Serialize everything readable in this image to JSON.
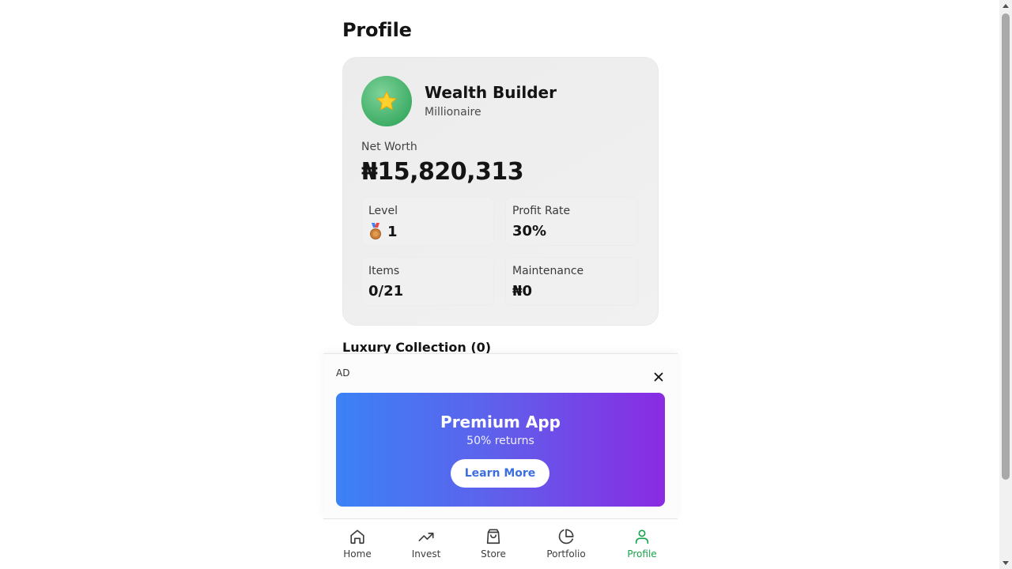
{
  "page": {
    "title": "Profile"
  },
  "profile": {
    "avatar_icon": "star-icon",
    "name": "Wealth Builder",
    "rank": "Millionaire",
    "net_worth_label": "Net Worth",
    "net_worth_value": "₦15,820,313"
  },
  "stats": {
    "level": {
      "label": "Level",
      "value": "1",
      "icon": "bronze-medal-icon"
    },
    "profit_rate": {
      "label": "Profit Rate",
      "value": "30%"
    },
    "items": {
      "label": "Items",
      "value": "0/21"
    },
    "maintenance": {
      "label": "Maintenance",
      "value": "₦0"
    }
  },
  "collection": {
    "title": "Luxury Collection (0)"
  },
  "ad": {
    "tag": "AD",
    "title": "Premium App",
    "subtitle": "50% returns",
    "cta": "Learn More",
    "gradient": [
      "#3b82f6",
      "#8a2be2"
    ]
  },
  "nav": {
    "active_color": "#16a34a",
    "items": [
      {
        "label": "Home",
        "icon": "home-icon"
      },
      {
        "label": "Invest",
        "icon": "trending-up-icon"
      },
      {
        "label": "Store",
        "icon": "shopping-bag-icon"
      },
      {
        "label": "Portfolio",
        "icon": "pie-chart-icon"
      },
      {
        "label": "Profile",
        "icon": "user-icon",
        "active": true
      }
    ]
  }
}
